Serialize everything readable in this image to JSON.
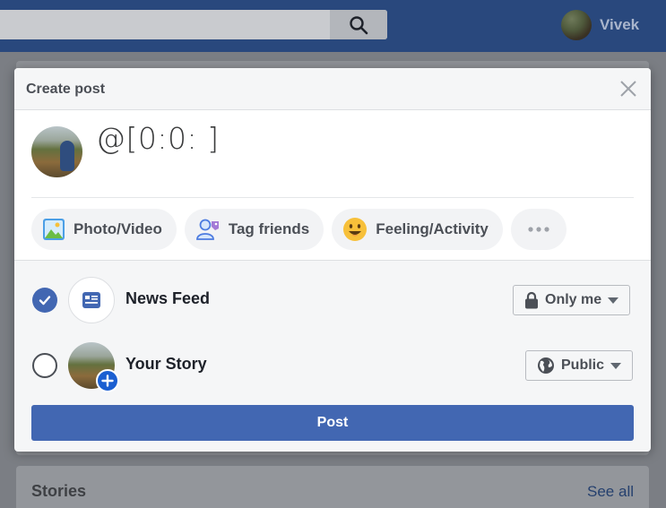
{
  "topbar": {
    "user_name": "Vivek"
  },
  "modal": {
    "title": "Create post",
    "compose_text": "@[0:0: ]",
    "actions": [
      {
        "label": "Photo/Video",
        "icon": "photo-icon"
      },
      {
        "label": "Tag friends",
        "icon": "tag-friends-icon"
      },
      {
        "label": "Feeling/Activity",
        "icon": "feeling-icon"
      },
      {
        "label": "",
        "icon": "more-icon"
      }
    ],
    "audience": [
      {
        "label": "News Feed",
        "selected": true,
        "privacy": "Only me",
        "privacy_icon": "lock-icon"
      },
      {
        "label": "Your Story",
        "selected": false,
        "privacy": "Public",
        "privacy_icon": "globe-icon"
      }
    ],
    "post_label": "Post"
  },
  "background": {
    "section_title": "Stories",
    "see_all": "See all"
  },
  "colors": {
    "brand": "#4267b2",
    "topbar": "#29487d"
  }
}
